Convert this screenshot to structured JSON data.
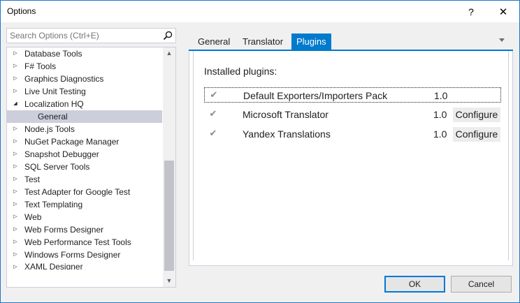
{
  "window": {
    "title": "Options",
    "help_glyph": "?",
    "close_glyph": "✕"
  },
  "search": {
    "placeholder": "Search Options (Ctrl+E)",
    "icon": "search-icon"
  },
  "tree": {
    "items": [
      {
        "label": "Database Tools",
        "arrow": "▷",
        "level": 0
      },
      {
        "label": "F# Tools",
        "arrow": "▷",
        "level": 0
      },
      {
        "label": "Graphics Diagnostics",
        "arrow": "▷",
        "level": 0
      },
      {
        "label": "Live Unit Testing",
        "arrow": "▷",
        "level": 0
      },
      {
        "label": "Localization HQ",
        "arrow": "◢",
        "level": 0
      },
      {
        "label": "General",
        "arrow": "",
        "level": 1,
        "selected": true
      },
      {
        "label": "Node.js Tools",
        "arrow": "▷",
        "level": 0
      },
      {
        "label": "NuGet Package Manager",
        "arrow": "▷",
        "level": 0
      },
      {
        "label": "Snapshot Debugger",
        "arrow": "▷",
        "level": 0
      },
      {
        "label": "SQL Server Tools",
        "arrow": "▷",
        "level": 0
      },
      {
        "label": "Test",
        "arrow": "▷",
        "level": 0
      },
      {
        "label": "Test Adapter for Google Test",
        "arrow": "▷",
        "level": 0
      },
      {
        "label": "Text Templating",
        "arrow": "▷",
        "level": 0
      },
      {
        "label": "Web",
        "arrow": "▷",
        "level": 0
      },
      {
        "label": "Web Forms Designer",
        "arrow": "▷",
        "level": 0
      },
      {
        "label": "Web Performance Test Tools",
        "arrow": "▷",
        "level": 0
      },
      {
        "label": "Windows Forms Designer",
        "arrow": "▷",
        "level": 0
      },
      {
        "label": "XAML Designer",
        "arrow": "▷",
        "level": 0
      }
    ],
    "scroll_up_glyph": "▲",
    "scroll_down_glyph": "▼"
  },
  "tabs": [
    {
      "label": "General",
      "active": false
    },
    {
      "label": "Translator",
      "active": false
    },
    {
      "label": "Plugins",
      "active": true
    }
  ],
  "plugins": {
    "heading": "Installed plugins:",
    "check_glyph": "✔",
    "items": [
      {
        "name": "Default Exporters/Importers Pack",
        "version": "1.0",
        "checked": true,
        "configure": ""
      },
      {
        "name": "Microsoft Translator",
        "version": "1.0",
        "checked": true,
        "configure": "Configure"
      },
      {
        "name": "Yandex Translations",
        "version": "1.0",
        "checked": true,
        "configure": "Configure"
      }
    ]
  },
  "footer": {
    "ok_label": "OK",
    "cancel_label": "Cancel"
  },
  "colors": {
    "accent": "#007acc",
    "selected_bg": "#cccedb"
  }
}
